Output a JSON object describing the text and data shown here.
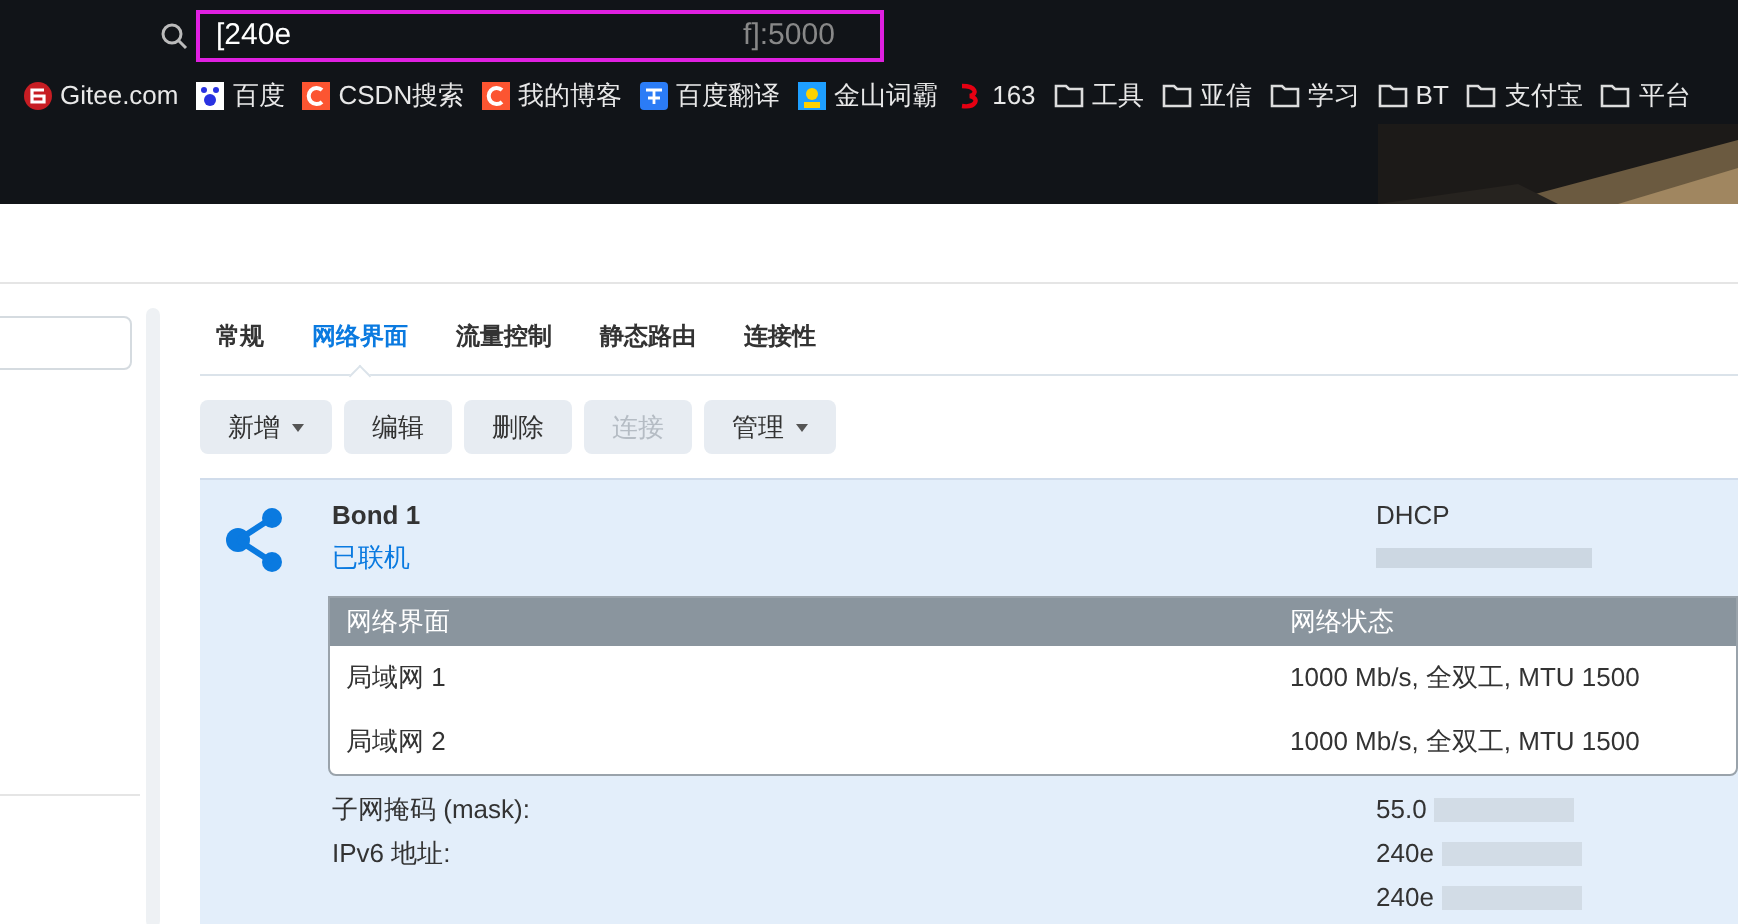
{
  "address_bar": {
    "url_start": "[240e",
    "url_end": "f]:5000"
  },
  "bookmarks": [
    {
      "label": "Gitee.com",
      "kind": "gitee"
    },
    {
      "label": "百度",
      "kind": "baidu"
    },
    {
      "label": "CSDN搜索",
      "kind": "csdn"
    },
    {
      "label": "我的博客",
      "kind": "csdn"
    },
    {
      "label": "百度翻译",
      "kind": "translate"
    },
    {
      "label": "金山词霸",
      "kind": "ciba"
    },
    {
      "label": "163",
      "kind": "netease"
    },
    {
      "label": "工具",
      "kind": "folder"
    },
    {
      "label": "亚信",
      "kind": "folder"
    },
    {
      "label": "学习",
      "kind": "folder"
    },
    {
      "label": "BT",
      "kind": "folder"
    },
    {
      "label": "支付宝",
      "kind": "folder"
    },
    {
      "label": "平台",
      "kind": "folder"
    }
  ],
  "tabs": [
    {
      "label": "常规",
      "selected": false
    },
    {
      "label": "网络界面",
      "selected": true
    },
    {
      "label": "流量控制",
      "selected": false
    },
    {
      "label": "静态路由",
      "selected": false
    },
    {
      "label": "连接性",
      "selected": false
    }
  ],
  "toolbar": [
    {
      "label": "新增",
      "menu": true,
      "disabled": false
    },
    {
      "label": "编辑",
      "menu": false,
      "disabled": false
    },
    {
      "label": "删除",
      "menu": false,
      "disabled": false
    },
    {
      "label": "连接",
      "menu": false,
      "disabled": true
    },
    {
      "label": "管理",
      "menu": true,
      "disabled": false
    }
  ],
  "interface": {
    "name": "Bond 1",
    "status": "已联机",
    "mode": "DHCP",
    "table": {
      "columns": [
        "网络界面",
        "网络状态"
      ],
      "rows": [
        [
          "局域网 1",
          "1000 Mb/s, 全双工, MTU 1500"
        ],
        [
          "局域网 2",
          "1000 Mb/s, 全双工, MTU 1500"
        ]
      ]
    },
    "details": [
      {
        "label": "子网掩码 (mask):",
        "values": [
          "55.0"
        ]
      },
      {
        "label": "IPv6 地址:",
        "values": [
          "240e",
          "240e"
        ]
      }
    ]
  }
}
